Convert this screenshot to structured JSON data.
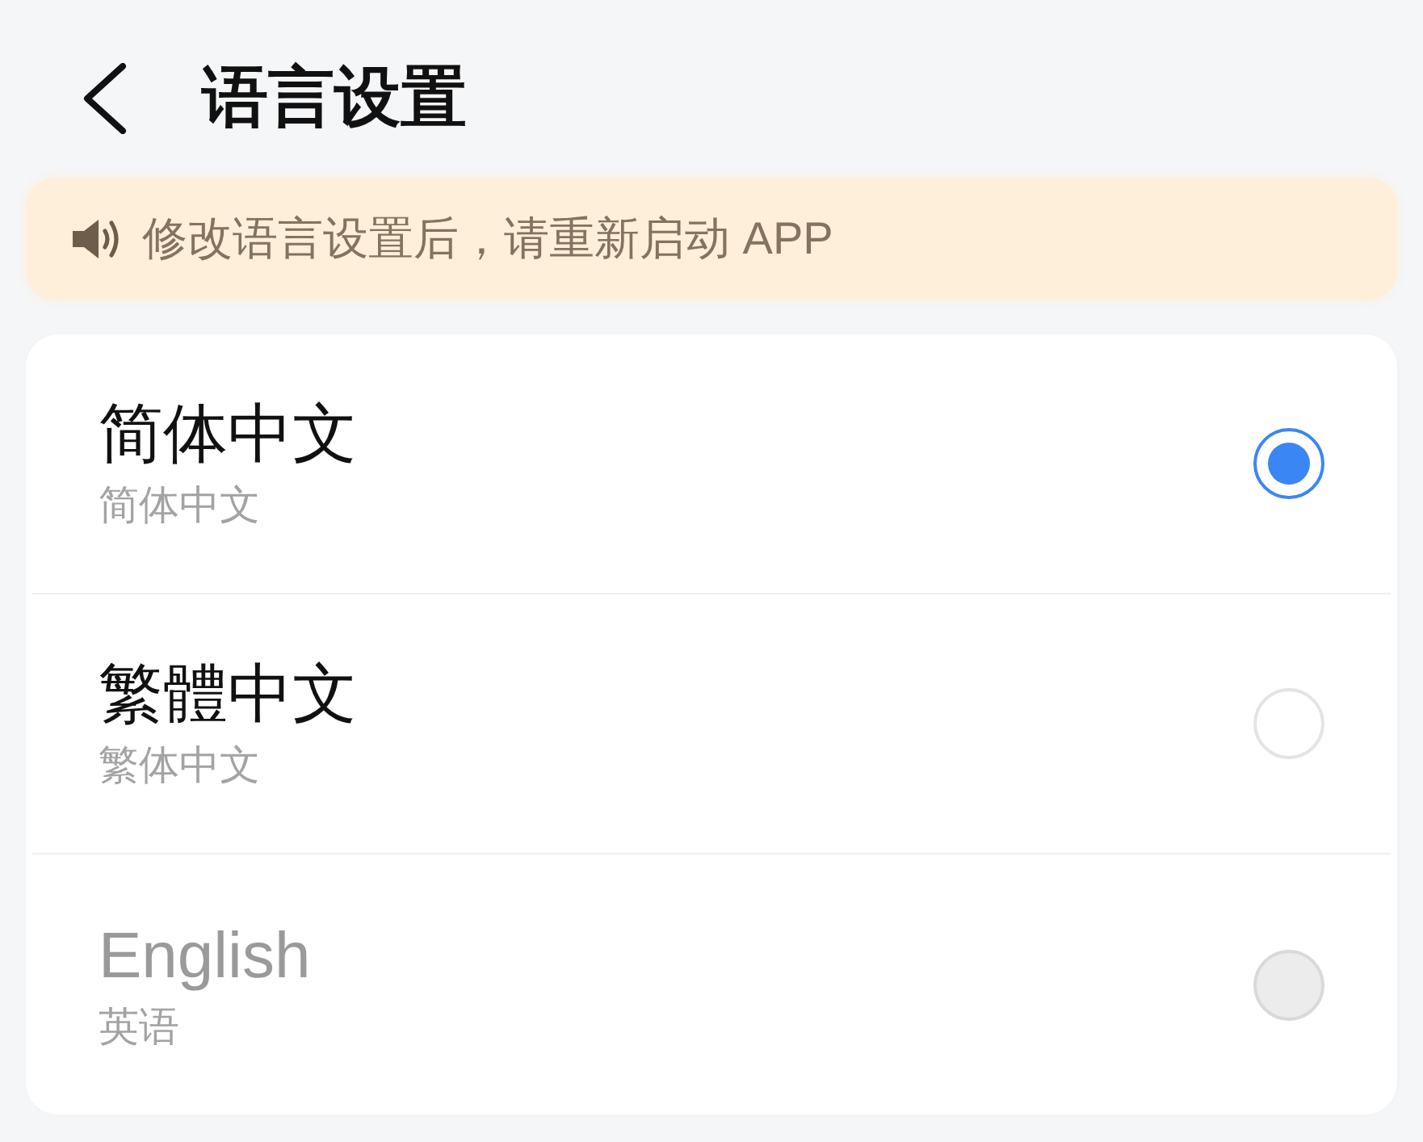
{
  "header": {
    "title": "语言设置"
  },
  "notice": {
    "text": "修改语言设置后，请重新启动 APP"
  },
  "languages": [
    {
      "name": "简体中文",
      "subtitle": "简体中文",
      "selected": true,
      "disabled": false
    },
    {
      "name": "繁體中文",
      "subtitle": "繁体中文",
      "selected": false,
      "disabled": false
    },
    {
      "name": "English",
      "subtitle": "英语",
      "selected": false,
      "disabled": true
    }
  ]
}
